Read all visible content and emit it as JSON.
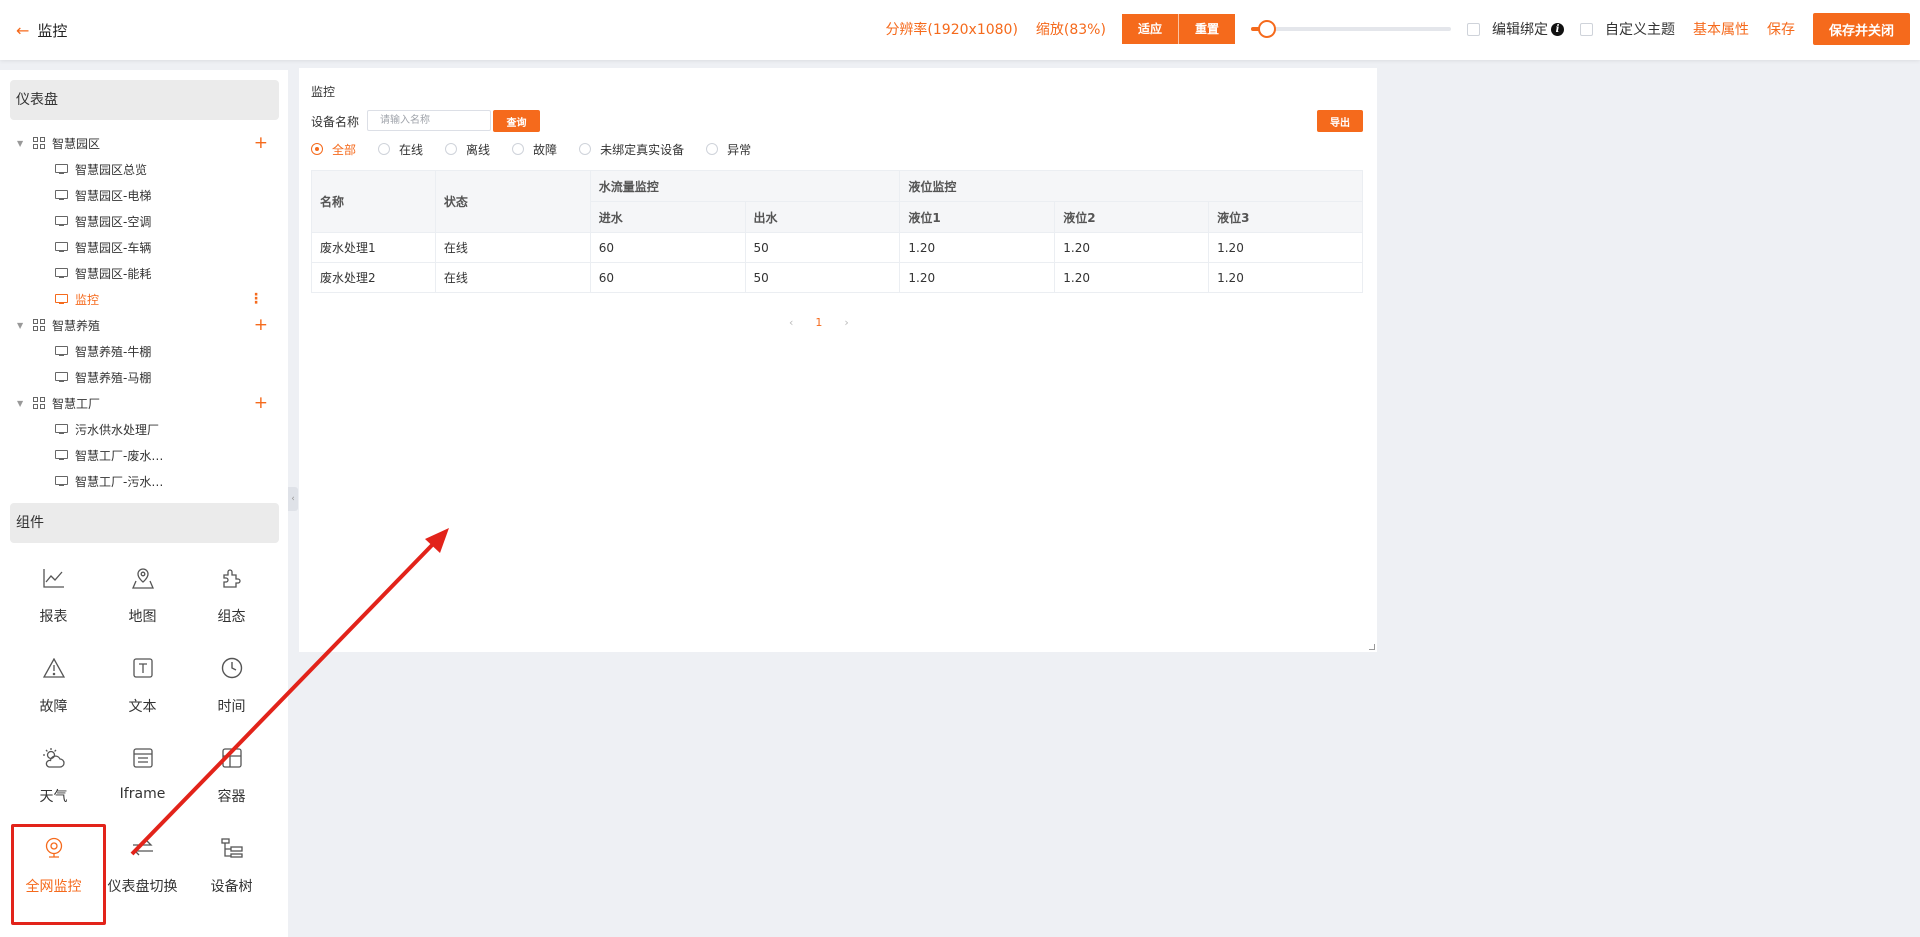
{
  "header": {
    "back_label": "监控",
    "resolution": "分辨率(1920x1080)",
    "zoom": "缩放(83%)",
    "fit_label": "适应",
    "reset_label": "重置",
    "zoom_slider_value": 0.08,
    "edit_binding_label": "编辑绑定",
    "custom_theme_label": "自定义主题",
    "basic_props_label": "基本属性",
    "save_label": "保存",
    "save_close_label": "保存并关闭"
  },
  "sidebar": {
    "dashboard_title": "仪表盘",
    "tree": [
      {
        "label": "智慧园区",
        "type": "group"
      },
      {
        "label": "智慧园区总览",
        "type": "item"
      },
      {
        "label": "智慧园区-电梯",
        "type": "item"
      },
      {
        "label": "智慧园区-空调",
        "type": "item"
      },
      {
        "label": "智慧园区-车辆",
        "type": "item"
      },
      {
        "label": "智慧园区-能耗",
        "type": "item"
      },
      {
        "label": "监控",
        "type": "item",
        "active": true
      },
      {
        "label": "智慧养殖",
        "type": "group"
      },
      {
        "label": "智慧养殖-牛棚",
        "type": "item"
      },
      {
        "label": "智慧养殖-马棚",
        "type": "item"
      },
      {
        "label": "智慧工厂",
        "type": "group"
      },
      {
        "label": "污水供水处理厂",
        "type": "item"
      },
      {
        "label": "智慧工厂-废水…",
        "type": "item"
      },
      {
        "label": "智慧工厂-污水…",
        "type": "item"
      }
    ],
    "components_title": "组件",
    "components": [
      {
        "label": "报表",
        "icon": "chart-line-icon"
      },
      {
        "label": "地图",
        "icon": "map-icon"
      },
      {
        "label": "组态",
        "icon": "puzzle-icon"
      },
      {
        "label": "故障",
        "icon": "warning-icon"
      },
      {
        "label": "文本",
        "icon": "text-icon"
      },
      {
        "label": "时间",
        "icon": "clock-icon"
      },
      {
        "label": "天气",
        "icon": "weather-icon"
      },
      {
        "label": "Iframe",
        "icon": "iframe-icon"
      },
      {
        "label": "容器",
        "icon": "container-icon"
      },
      {
        "label": "全网监控",
        "icon": "camera-icon",
        "selected": true
      },
      {
        "label": "仪表盘切换",
        "icon": "switch-icon"
      },
      {
        "label": "设备树",
        "icon": "device-tree-icon"
      }
    ]
  },
  "canvas": {
    "title": "监控",
    "device_name_label": "设备名称",
    "device_name_placeholder": "请输入名称",
    "query_label": "查询",
    "export_label": "导出",
    "filters": [
      "全部",
      "在线",
      "离线",
      "故障",
      "未绑定真实设备",
      "异常"
    ],
    "selected_filter": "全部",
    "table": {
      "group_headers": {
        "name": "名称",
        "status": "状态",
        "water": "水流量监控",
        "level": "液位监控"
      },
      "sub_headers": [
        "进水",
        "出水",
        "液位1",
        "液位2",
        "液位3"
      ],
      "rows": [
        {
          "name": "废水处理1",
          "status": "在线",
          "in": "60",
          "out": "50",
          "l1": "1.20",
          "l2": "1.20",
          "l3": "1.20"
        },
        {
          "name": "废水处理2",
          "status": "在线",
          "in": "60",
          "out": "50",
          "l1": "1.20",
          "l2": "1.20",
          "l3": "1.20"
        }
      ]
    },
    "pagination": {
      "current": "1",
      "prev": "‹",
      "next": "›"
    }
  },
  "colors": {
    "accent": "#f56a1c",
    "annotation": "#e2231a",
    "in_value": "#2d8cf0",
    "out_value": "#5bb030"
  }
}
